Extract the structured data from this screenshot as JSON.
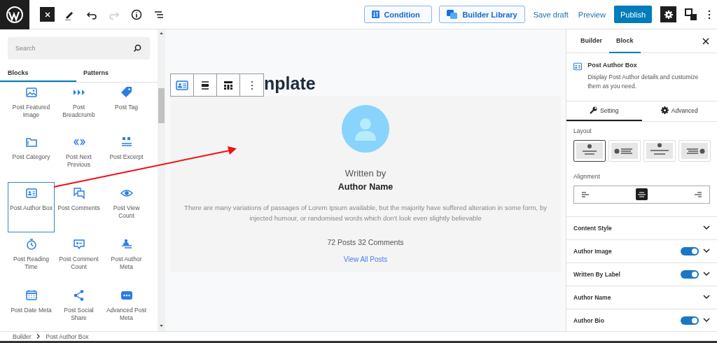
{
  "top_bar": {
    "tools": [
      {
        "kind": "close",
        "disabled": false
      },
      {
        "kind": "pencil",
        "disabled": false
      },
      {
        "kind": "undo",
        "disabled": false
      },
      {
        "kind": "redo",
        "disabled": true
      },
      {
        "kind": "info",
        "disabled": false
      },
      {
        "kind": "list",
        "disabled": false
      }
    ],
    "actions": [
      {
        "kind": "outline",
        "label": "Condition"
      },
      {
        "kind": "outline",
        "label": "Builder Library"
      },
      {
        "kind": "link",
        "label": "Save draft"
      },
      {
        "kind": "link",
        "label": "Preview"
      },
      {
        "kind": "primary",
        "label": "Publish"
      }
    ]
  },
  "inserter": {
    "search": {
      "placeholder": "Search"
    },
    "tabs": [
      {
        "label": "Blocks",
        "selected": true
      },
      {
        "label": "Patterns",
        "selected": false
      }
    ],
    "blocks": [
      {
        "label": "Post Featured Image",
        "selected": false
      },
      {
        "label": "Post Breadcrumb",
        "selected": false
      },
      {
        "label": "Post Tag",
        "selected": false
      },
      {
        "label": "Post Category",
        "selected": false
      },
      {
        "label": "Post Next Previous",
        "selected": false
      },
      {
        "label": "Post Excerpt",
        "selected": false
      },
      {
        "label": "Post Author Box",
        "selected": true
      },
      {
        "label": "Post Comments",
        "selected": false
      },
      {
        "label": "Post View Count",
        "selected": false
      },
      {
        "label": "Post Reading Time",
        "selected": false
      },
      {
        "label": "Post Comment Count",
        "selected": false
      },
      {
        "label": "Post Author Meta",
        "selected": false
      },
      {
        "label": "Post Date Meta",
        "selected": false
      },
      {
        "label": "Post Social Share",
        "selected": false
      },
      {
        "label": "Advanced Post Meta",
        "selected": false
      }
    ]
  },
  "canvas": {
    "title": "nplate",
    "author_box": {
      "written_by": "Written by",
      "name": "Author Name",
      "bio": "There are many variations of passages of Lorem Ipsum available, but the majority have suffered alteration in some form, by injected humour, or randomised words which don't look even slightly believable",
      "stats": "72 Posts 32 Comments",
      "link": "View All Posts"
    }
  },
  "settings": {
    "tabs": [
      {
        "label": "Builder",
        "selected": false
      },
      {
        "label": "Block",
        "selected": true
      }
    ],
    "block": {
      "name": "Post Author Box",
      "description": "Display Post Author details and customize them as you need."
    },
    "sub_tabs": [
      {
        "label": "Setting",
        "selected": true
      },
      {
        "label": "Advanced",
        "selected": false
      }
    ],
    "layout_label": "Layout",
    "layouts": [
      {
        "selected": true
      },
      {
        "selected": false
      },
      {
        "selected": false
      },
      {
        "selected": false
      }
    ],
    "alignment_label": "Alignment",
    "alignments": [
      {
        "selected": false
      },
      {
        "selected": true
      },
      {
        "selected": false
      }
    ],
    "panels": [
      {
        "label": "Content Style",
        "kind": "plain"
      },
      {
        "label": "Author Image",
        "kind": "toggle",
        "on": true
      },
      {
        "label": "Written By Label",
        "kind": "toggle",
        "on": true
      },
      {
        "label": "Author Name",
        "kind": "plain"
      },
      {
        "label": "Author Bio",
        "kind": "toggle",
        "on": true
      }
    ]
  },
  "breadcrumb": [
    {
      "label": "Builder"
    },
    {
      "label": "Post Author Box"
    }
  ]
}
